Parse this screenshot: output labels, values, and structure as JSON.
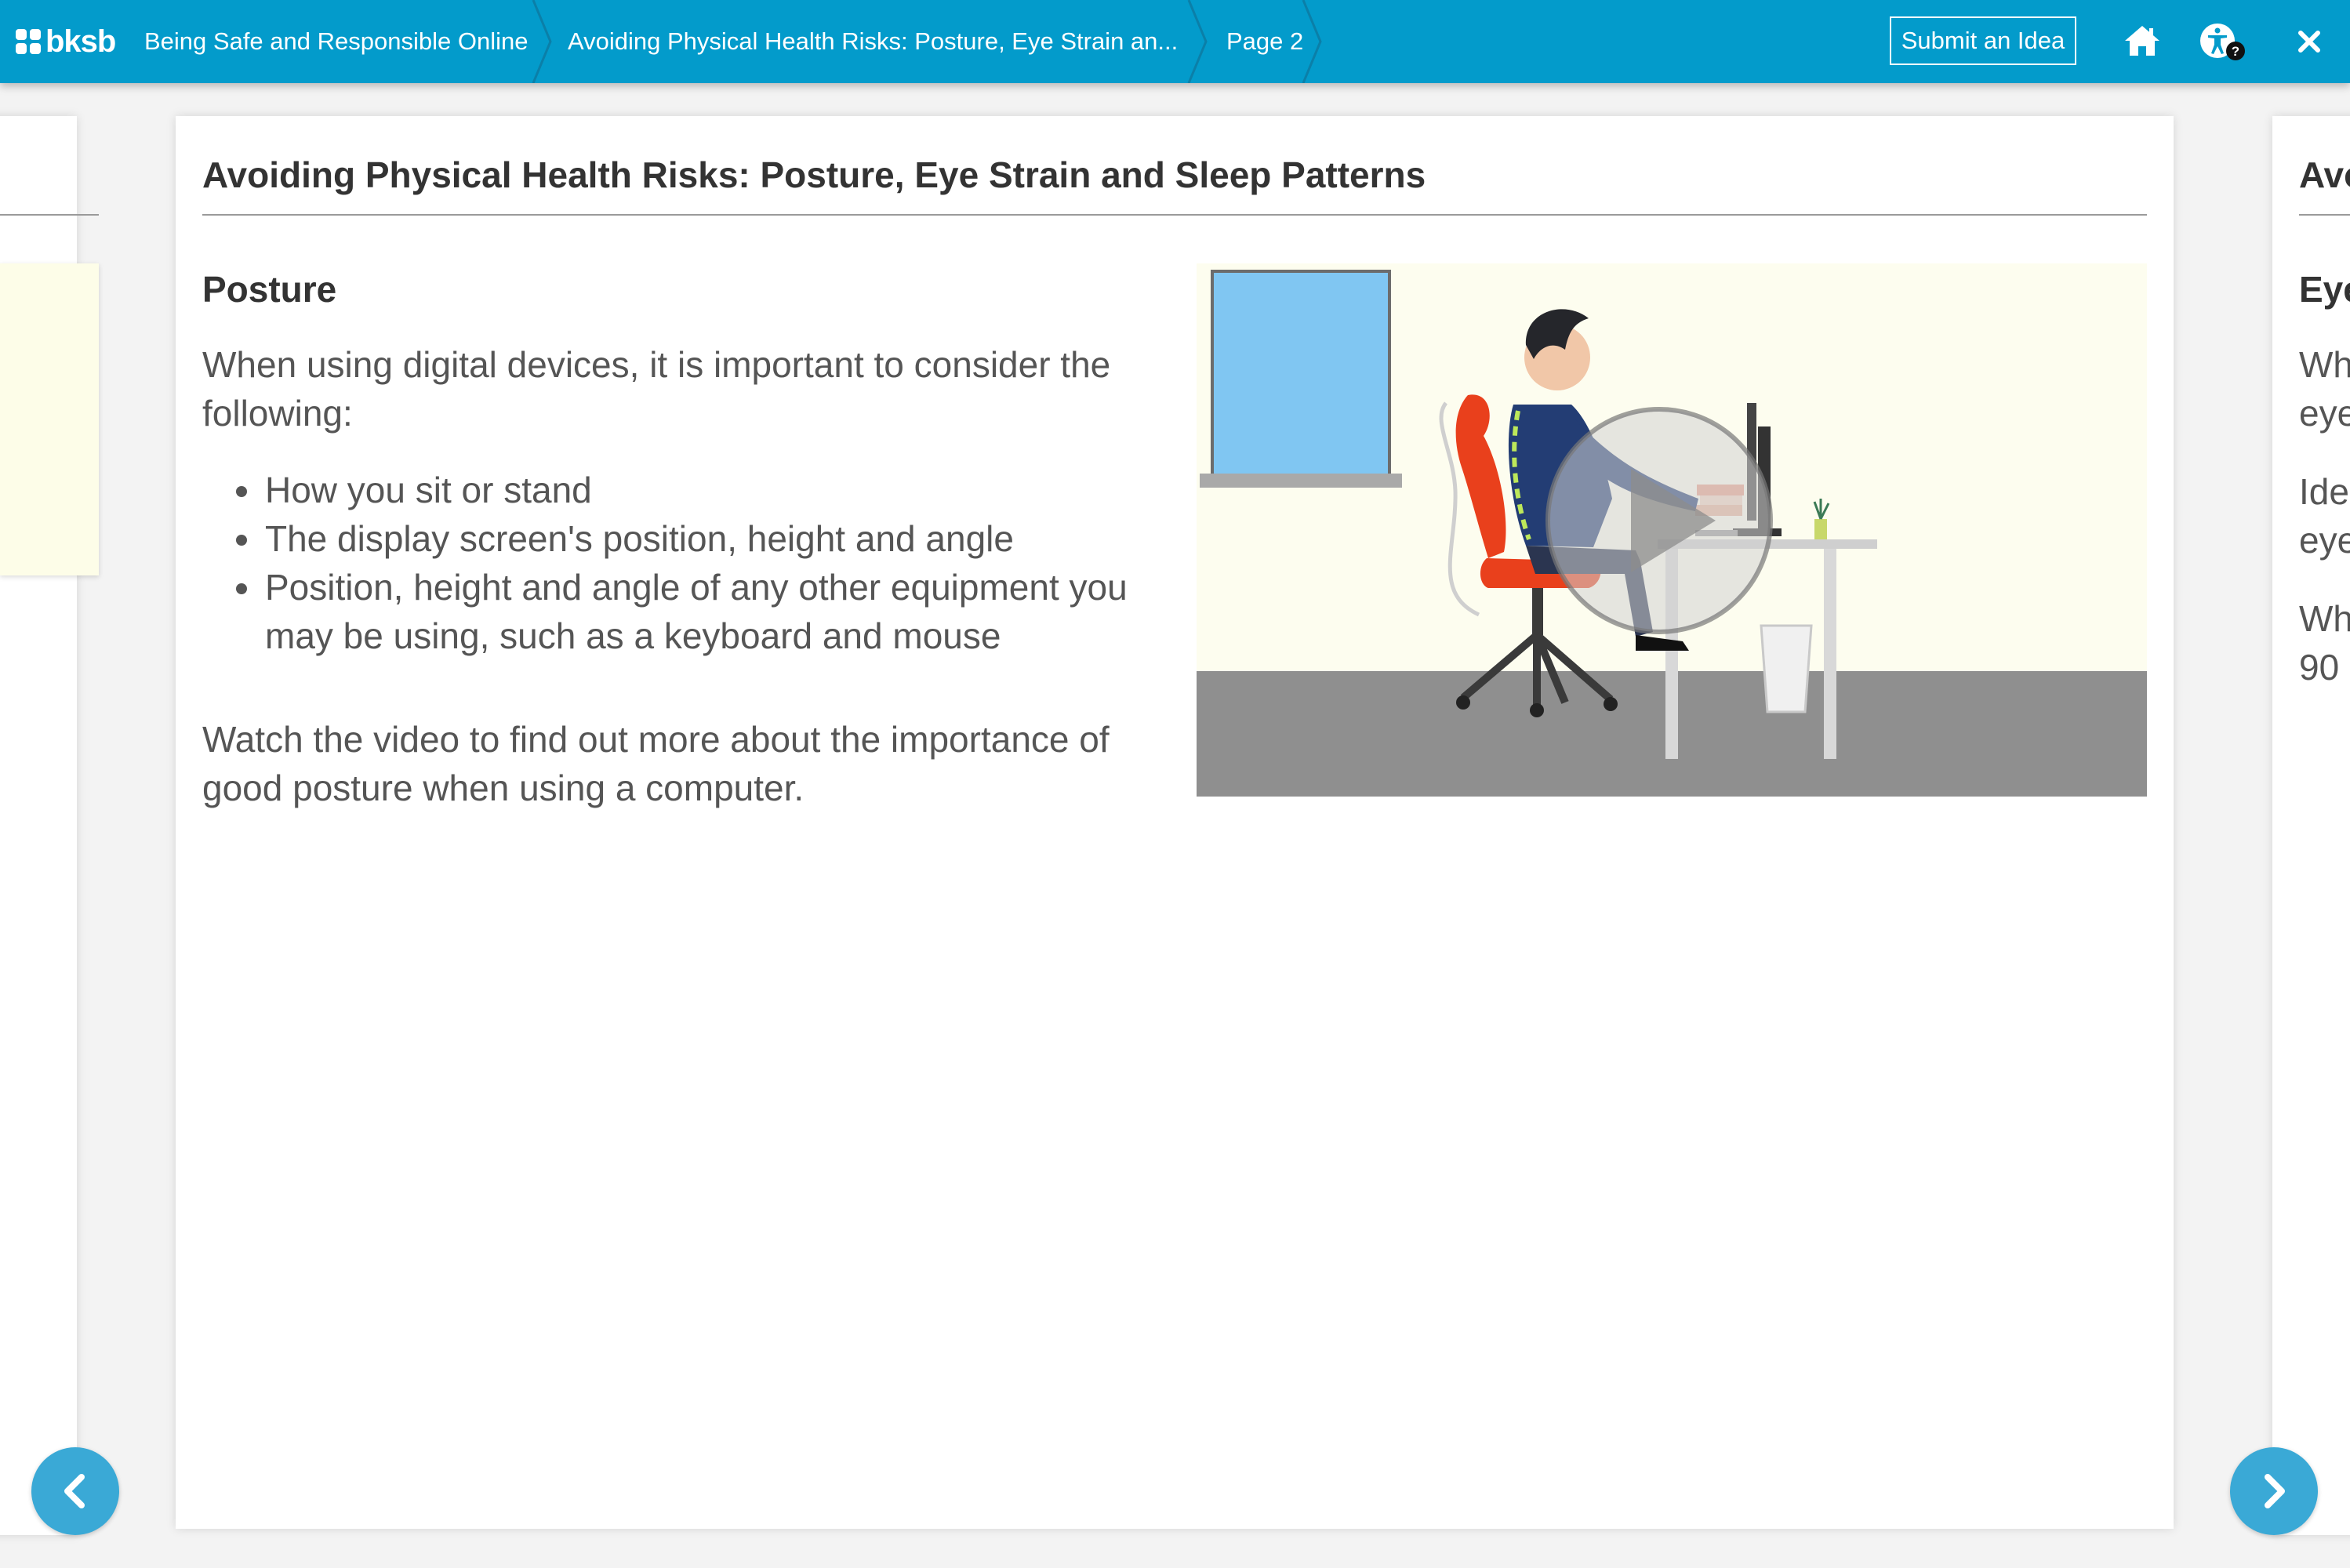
{
  "header": {
    "logo_text": "bksb",
    "breadcrumbs": [
      "Being Safe and Responsible Online",
      "Avoiding Physical Health Risks: Posture, Eye Strain an...",
      "Page 2"
    ],
    "submit_idea_label": "Submit an Idea",
    "icons": [
      "home-icon",
      "accessibility-help-icon",
      "close-icon"
    ],
    "accent_color": "#039bcb"
  },
  "main_card": {
    "title": "Avoiding Physical Health Risks: Posture, Eye Strain and Sleep Patterns",
    "section_heading": "Posture",
    "intro": "When using digital devices, it is important to consider the following:",
    "bullets": [
      "How you sit or stand",
      "The display screen's position, height and angle",
      "Position, height and angle of any other equipment you may be using, such as a keyboard and mouse"
    ],
    "outro": "Watch the video to find out more about the importance of good posture when using a computer.",
    "video_icon": "play-icon"
  },
  "next_card_peek": {
    "title": "Avo",
    "heading": "Eye",
    "lines": [
      "Wh",
      "eye",
      "Ide",
      "eye",
      "Wh",
      "90"
    ]
  },
  "navigation": {
    "prev_icon": "chevron-left-icon",
    "next_icon": "chevron-right-icon"
  }
}
